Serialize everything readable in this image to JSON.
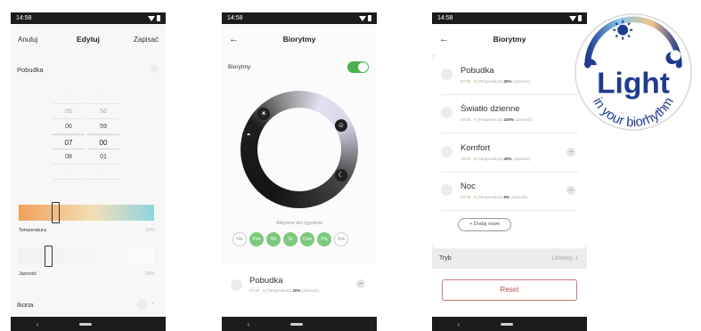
{
  "phone1": {
    "time": "14:58",
    "header": {
      "cancel": "Anuluj",
      "title": "Edytuj",
      "save": "Zapisać"
    },
    "wake_label": "Pobudka",
    "picker": {
      "hours": [
        "05",
        "06",
        "07",
        "08"
      ],
      "minutes": [
        "58",
        "59",
        "00",
        "01"
      ],
      "hours_faint": [
        "--",
        "--"
      ],
      "minutes_faint": [
        "--",
        "--"
      ]
    },
    "temperature_label": "Temperatura",
    "temperature_pct": "25%",
    "temperature_value": 0.27,
    "brightness_label": "Jasność",
    "brightness_pct": "20%",
    "brightness_value": 0.22,
    "icon_label": "Ikona",
    "chevron": "›"
  },
  "phone2": {
    "time": "14:58",
    "title": "Biorytmy",
    "toggle_label": "Biorytmy",
    "toggle_on": true,
    "active_days_title": "Aktywne dni tygodnia",
    "days": [
      {
        "label": "Nie",
        "on": false
      },
      {
        "label": "Pon",
        "on": true
      },
      {
        "label": "Wt",
        "on": true
      },
      {
        "label": "Śr",
        "on": true
      },
      {
        "label": "Czw",
        "on": true
      },
      {
        "label": "Pią",
        "on": true
      },
      {
        "label": "Sob",
        "on": false
      }
    ],
    "item": {
      "name": "Pobudka",
      "time": "07:00",
      "temp_label": "(Temperatura)",
      "pct": "20%",
      "bright_label": "(Jasność)"
    },
    "ring_icons": [
      "sun-icon",
      "sunrise-icon",
      "smile-icon",
      "moon-icon"
    ]
  },
  "phone3": {
    "time": "14:58",
    "title": "Biorytmy",
    "items": [
      {
        "name": "Pobudka",
        "time": "07:00",
        "temp_label": "(Temperatura)",
        "pct": "20%",
        "bright_label": "(Jasność)"
      },
      {
        "name": "Światło dzienne",
        "time": "09:00",
        "temp_label": "(Temperatura)",
        "pct": "100%",
        "bright_label": "(Jasność)"
      },
      {
        "name": "Komfort",
        "time": "19:00",
        "temp_label": "(Temperatura)",
        "pct": "40%",
        "bright_label": "(Jasność)"
      },
      {
        "name": "Noc",
        "time": "20:00",
        "temp_label": "(Temperatura)",
        "pct": "5%",
        "bright_label": "(Jasność)"
      }
    ],
    "add_button": "+ Dodaj nowe",
    "mode_label": "Tryb",
    "mode_value": "Liniowy 1",
    "reset_button": "Reset"
  },
  "logo": {
    "word": "Light",
    "tagline_in": "in",
    "tagline_rest": "your biorhythm"
  },
  "colors": {
    "green": "#4caf50",
    "day_green": "#7cc97e",
    "reset_red": "#b34848",
    "logo_blue": "#1f3b8f"
  }
}
